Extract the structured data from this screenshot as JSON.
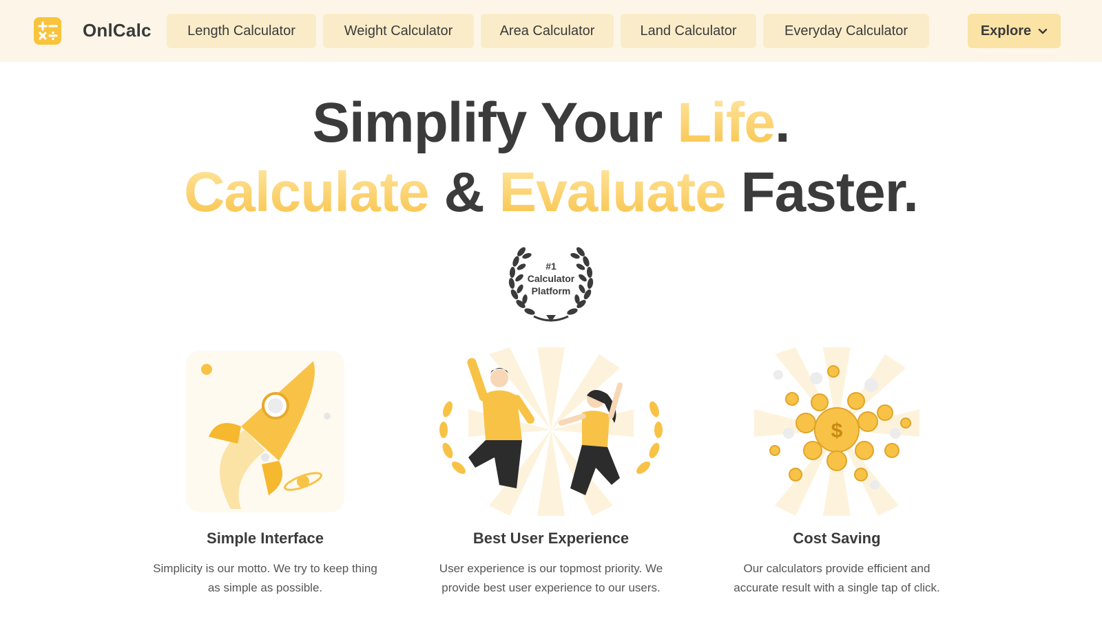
{
  "header": {
    "brand": "OnlCalc",
    "nav": [
      {
        "label": "Length Calculator"
      },
      {
        "label": "Weight Calculator"
      },
      {
        "label": "Area Calculator"
      },
      {
        "label": "Land Calculator"
      },
      {
        "label": "Everyday Calculator"
      }
    ],
    "explore_label": "Explore"
  },
  "hero": {
    "line1": [
      "Simplify Your ",
      "Life",
      "."
    ],
    "line2": [
      "Calculate",
      " & ",
      "Evaluate",
      " Faster."
    ]
  },
  "badge": {
    "line1": "#1",
    "line2": "Calculator",
    "line3": "Platform"
  },
  "features": [
    {
      "title": "Simple Interface",
      "desc_line1": "Simplicity is our motto. We try to keep thing",
      "desc_line2": "as simple as possible.",
      "illustration": "rocket"
    },
    {
      "title": "Best User Experience",
      "desc_line1": "User experience is our topmost priority. We",
      "desc_line2": "provide best user experience to our users.",
      "illustration": "happy-people"
    },
    {
      "title": "Cost Saving",
      "desc_line1": "Our calculators provide efficient and",
      "desc_line2": "accurate result with a single tap of click.",
      "illustration": "coins"
    }
  ],
  "colors": {
    "accent": "#f8c246",
    "header_bg": "#fdf6e8",
    "nav_bg": "#fbecc9",
    "text_dark": "#3b3b3b"
  }
}
